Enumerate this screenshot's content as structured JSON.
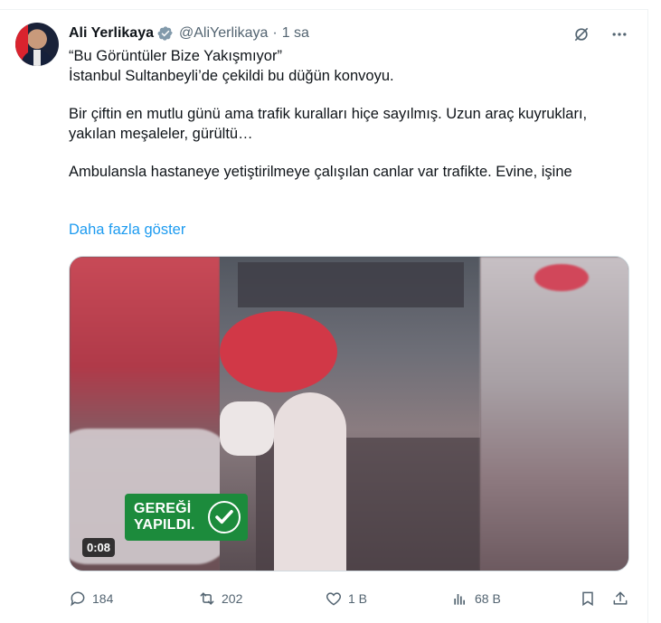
{
  "tweet": {
    "author_name": "Ali Yerlikaya",
    "handle": "@AliYerlikaya",
    "separator": "·",
    "time": "1 sa",
    "lines": [
      "“Bu Görüntüler Bize Yakışmıyor”",
      "İstanbul Sultanbeyli’de çekildi bu düğün konvoyu.",
      "Bir çiftin en mutlu günü ama trafik kuralları hiçe sayılmış. Uzun araç kuyrukları, yakılan meşaleler, gürültü…",
      "Ambulansla hastaneye yetiştirilmeye çalışılan canlar var trafikte. Evine, işine"
    ],
    "show_more": "Daha fazla göster"
  },
  "media": {
    "badge_line1": "GEREĞİ",
    "badge_line2": "YAPILDI.",
    "duration": "0:08"
  },
  "actions": {
    "replies": "184",
    "reposts": "202",
    "likes": "1 B",
    "views": "68 B"
  },
  "colors": {
    "link": "#1d9bf0",
    "secondary": "#536471",
    "verified": "#829aab",
    "badge_green": "#1c8b3c"
  }
}
